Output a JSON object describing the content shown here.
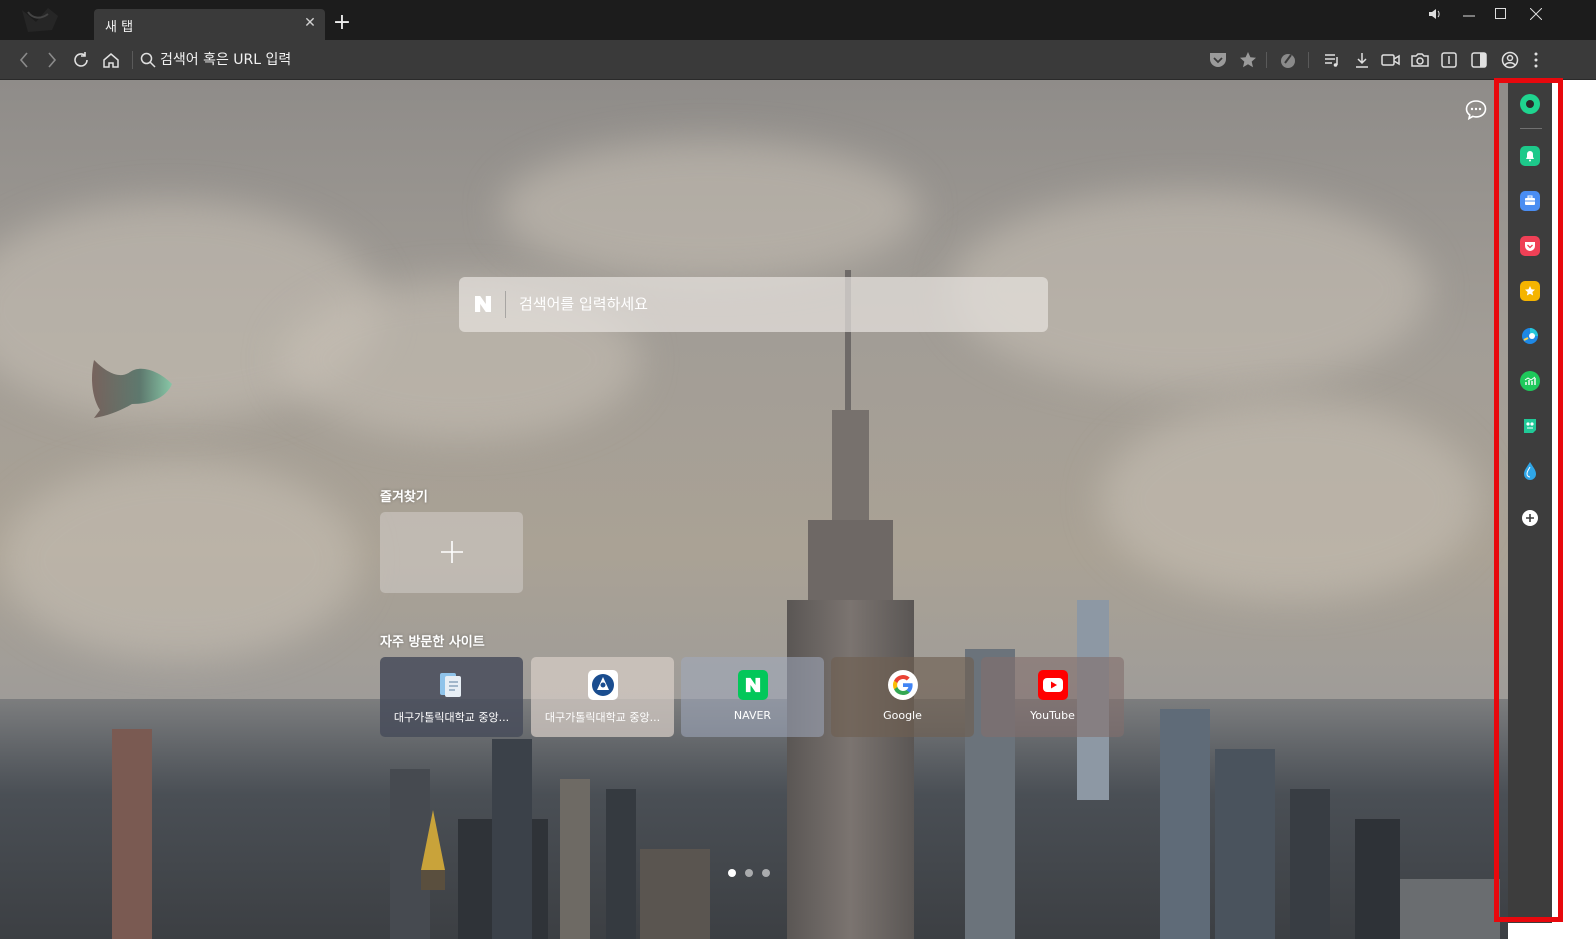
{
  "browser": {
    "tab_title": "새 탭",
    "address_placeholder": "검색어 혹은 URL 입력"
  },
  "newtab": {
    "search_placeholder": "검색어를 입력하세요",
    "search_engine_logo": "N",
    "favorites_label": "즐겨찾기",
    "frequent_label": "자주 방문한 사이트",
    "tiles": [
      {
        "label": "대구가톨릭대학교 중앙...",
        "icon": "document-icon"
      },
      {
        "label": "대구가톨릭대학교 중앙...",
        "icon": "university-emblem-icon"
      },
      {
        "label": "NAVER",
        "icon": "naver-icon"
      },
      {
        "label": "Google",
        "icon": "google-icon"
      },
      {
        "label": "YouTube",
        "icon": "youtube-icon"
      }
    ],
    "pages": 3,
    "current_page": 1
  },
  "sidebar": {
    "items": [
      "greendot-icon",
      "bell-icon",
      "briefcase-icon",
      "pocket-icon",
      "star-icon",
      "globe-icon",
      "chart-icon",
      "papago-icon",
      "drop-icon",
      "add-icon"
    ]
  },
  "colors": {
    "highlight": "#e8080d",
    "naver": "#03c75a",
    "youtube": "#ff0000",
    "sidebar_bg": "#3d3d3d"
  }
}
